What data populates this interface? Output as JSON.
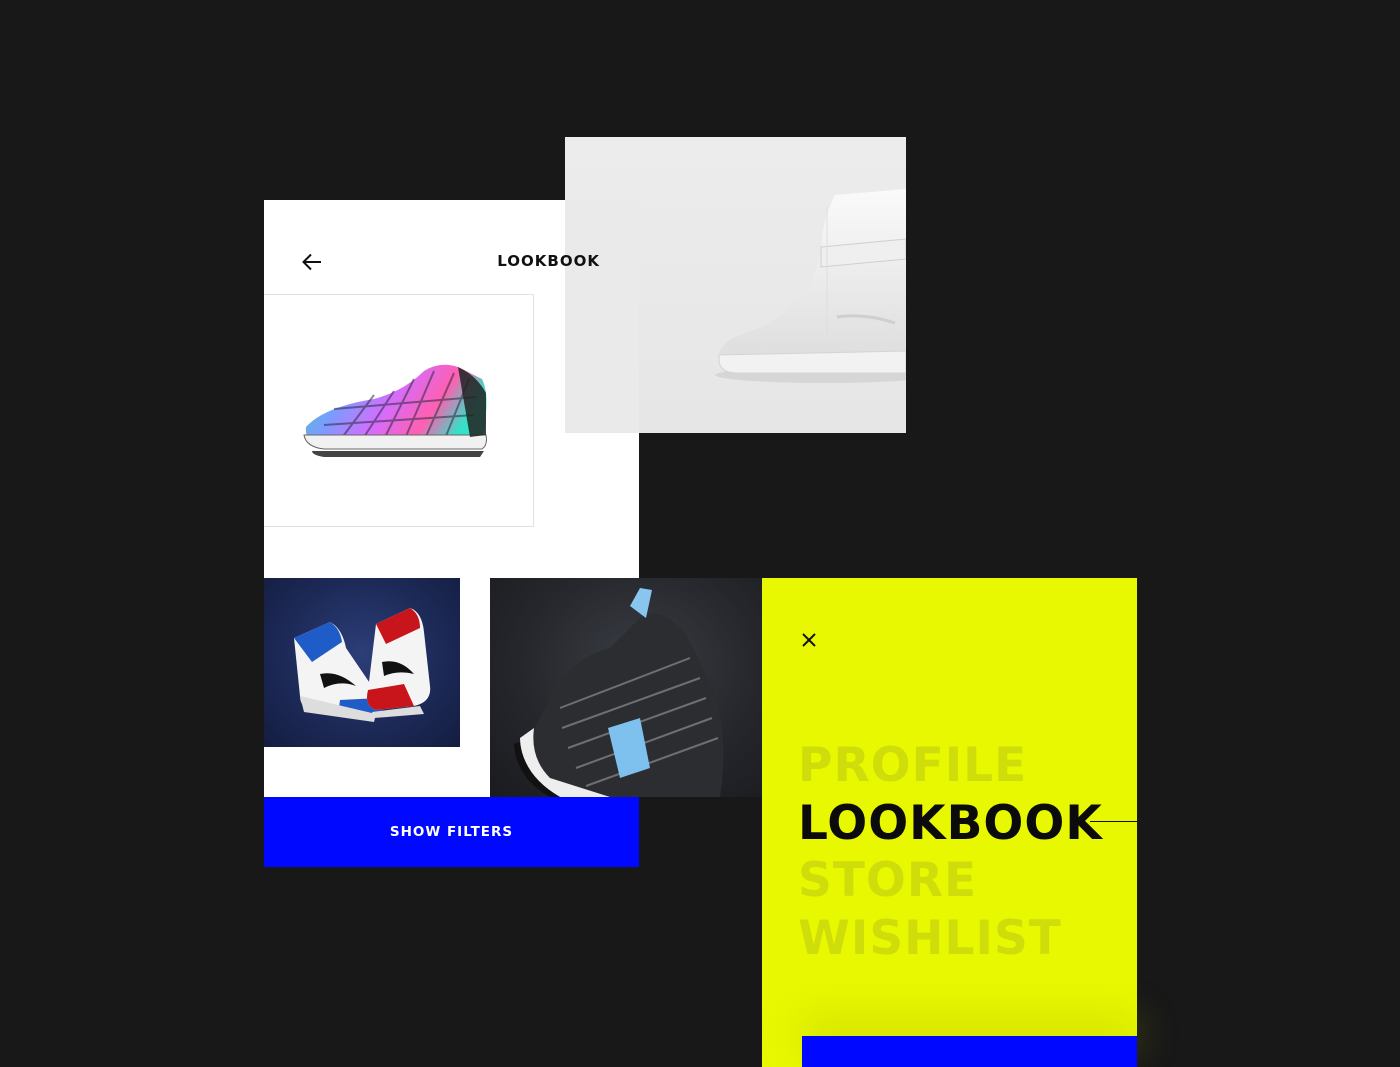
{
  "lookbook_screen": {
    "title": "LOOKBOOK",
    "back_icon": "arrow-left-icon",
    "filters_label": "SHOW FILTERS"
  },
  "menu_screen": {
    "close_icon": "close-icon",
    "items": [
      {
        "label": "PROFILE",
        "active": false
      },
      {
        "label": "LOOKBOOK",
        "active": true
      },
      {
        "label": "STORE",
        "active": false
      },
      {
        "label": "WISHLIST",
        "active": false
      }
    ]
  },
  "colors": {
    "background": "#181818",
    "accent_blue": "#0008ff",
    "menu_yellow": "#e8f800",
    "menu_inactive": "#cfdd0a"
  }
}
